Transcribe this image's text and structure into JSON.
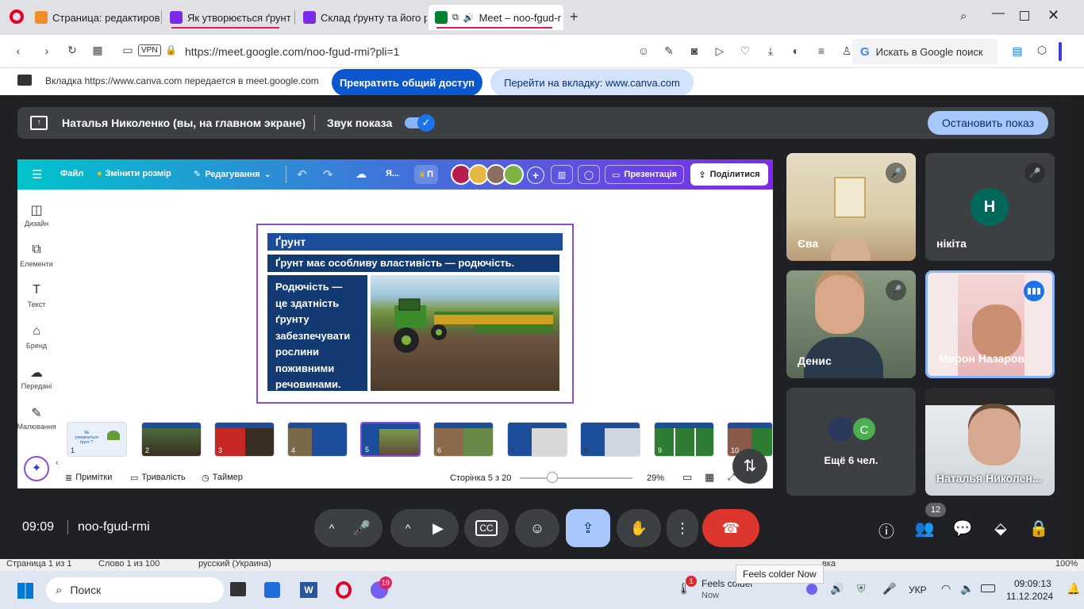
{
  "browser": {
    "tabs": [
      {
        "title": "Страница: редактирован",
        "color": "#f28c28"
      },
      {
        "title": "Як утворюється ґрунт? –",
        "color": "#7d2ae8"
      },
      {
        "title": "Склад ґрунту та його род",
        "color": "#7d2ae8"
      },
      {
        "title": "Meet – noo-fgud-r",
        "color": "#00832d"
      }
    ],
    "vpn": "VPN",
    "url": "https://meet.google.com/noo-fgud-rmi?pli=1",
    "search_label": "Искать в Google поиск"
  },
  "share_bar": {
    "message": "Вкладка https://www.canva.com передается в meet.google.com",
    "stop_label": "Прекратить общий доступ",
    "goto_label": "Перейти на вкладку: www.canva.com"
  },
  "presenting_bar": {
    "title": "Наталья Николенко (вы, на главном экране)",
    "sound_label": "Звук показа",
    "stop_label": "Остановить показ"
  },
  "canva": {
    "menu": {
      "file": "Файл",
      "resize": "Змінити розмір",
      "edit": "Редагування",
      "ya": "Я...",
      "p": "П",
      "present": "Презентація",
      "share": "Поділитися"
    },
    "sidebar": [
      "Дизайн",
      "Елементи",
      "Текст",
      "Бренд",
      "Передані",
      "Малювання"
    ],
    "slide": {
      "title": "Ґрунт",
      "subtitle": "Ґрунт має особливу властивість — родючість.",
      "body": [
        "Родючість —",
        "це здатність",
        "ґрунту",
        "забезпечувати",
        "рослини",
        "поживними",
        "речовинами."
      ]
    },
    "thumb_title": "Як утворюється ґрунт ?",
    "thumbnails": [
      "1",
      "2",
      "3",
      "4",
      "5",
      "6",
      "7",
      "8",
      "9",
      "10"
    ],
    "footer": {
      "notes": "Примітки",
      "duration": "Тривалість",
      "timer": "Таймер",
      "page": "Сторінка 5 з 20",
      "zoom": "29%"
    }
  },
  "participants": [
    {
      "name": "Єва"
    },
    {
      "name": "нікіта",
      "initial": "Н"
    },
    {
      "name": "Денис"
    },
    {
      "name": "Мирон Назаров"
    },
    {
      "name": "Ещё 6 чел.",
      "initial": "С"
    },
    {
      "name": "Наталья Николен..."
    }
  ],
  "meeting": {
    "time": "09:09",
    "code": "noo-fgud-rmi",
    "people_count": "12"
  },
  "tooltip": "Feels colder Now",
  "below_text": [
    "Страница 1 из 1",
    "Слово 1 из 100",
    "русский (Украина)",
    "вка",
    "100%"
  ],
  "taskbar": {
    "search": "Поиск",
    "viber_badge": "19",
    "weather": "Feels colder",
    "weather_sub": "Now",
    "weather_badge": "1",
    "lang": "УКР",
    "clock_time": "09:09:13",
    "clock_date": "11.12.2024"
  }
}
